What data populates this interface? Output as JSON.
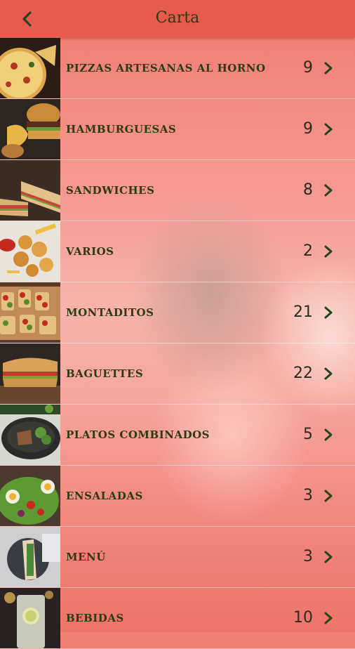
{
  "header": {
    "title": "Carta",
    "back_icon": "chevron-left-icon"
  },
  "colors": {
    "header": "#e75a4e",
    "text": "#2e3a10",
    "chevron": "#25441a"
  },
  "categories": [
    {
      "label": "PIZZAS ARTESANAS AL HORNO",
      "count": "9",
      "image": "pizza"
    },
    {
      "label": "HAMBURGUESAS",
      "count": "9",
      "image": "burger"
    },
    {
      "label": "SANDWICHES",
      "count": "8",
      "image": "sandwich"
    },
    {
      "label": "VARIOS",
      "count": "2",
      "image": "fried-food"
    },
    {
      "label": "MONTADITOS",
      "count": "21",
      "image": "montaditos"
    },
    {
      "label": "BAGUETTES",
      "count": "22",
      "image": "baguette"
    },
    {
      "label": "PLATOS COMBINADOS",
      "count": "5",
      "image": "combined-plate"
    },
    {
      "label": "ENSALADAS",
      "count": "3",
      "image": "salad"
    },
    {
      "label": "MENÚ",
      "count": "3",
      "image": "menu-plate"
    },
    {
      "label": "BEBIDAS",
      "count": "10",
      "image": "drink"
    }
  ]
}
